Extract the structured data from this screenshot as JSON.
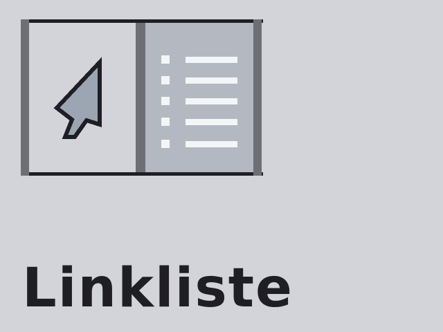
{
  "button": {
    "label": "Linkliste",
    "icon": "link-list-pane-icon"
  },
  "colors": {
    "background": "#d2d4d9",
    "frame_border": "#1e1e24",
    "left_pane": "#d2d4d9",
    "right_pane": "#b4b8c0",
    "divider": "#6e6f75",
    "cursor_fill": "#9ba6b2",
    "cursor_outline": "#1e1e24",
    "list_line": "#f4f5f7",
    "label_text": "#1e1e24"
  }
}
